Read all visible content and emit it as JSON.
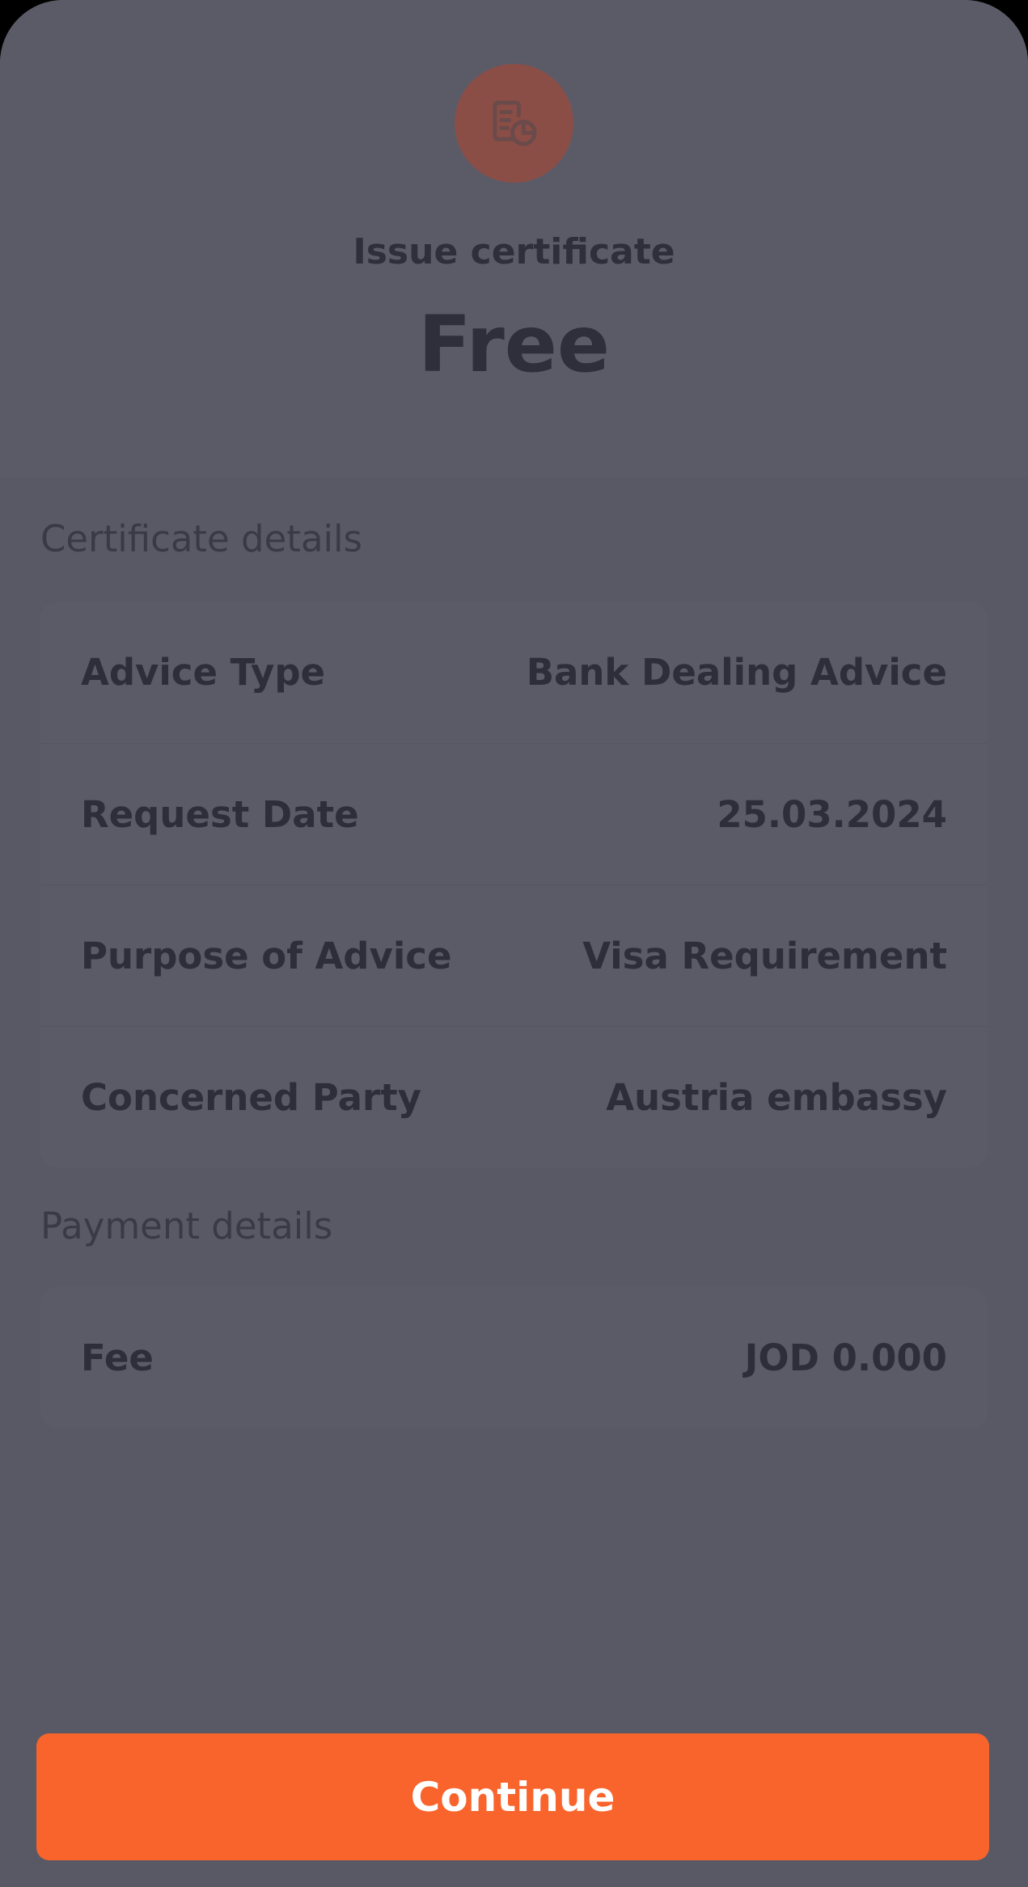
{
  "header": {
    "icon": "certificate-document-icon",
    "subtitle": "Issue certificate",
    "amount": "Free"
  },
  "certificate_details": {
    "title": "Certificate details",
    "rows": [
      {
        "label": "Advice Type",
        "value": "Bank Dealing Advice"
      },
      {
        "label": "Request Date",
        "value": "25.03.2024"
      },
      {
        "label": "Purpose of Advice",
        "value": "Visa Requirement"
      },
      {
        "label": "Concerned Party",
        "value": "Austria embassy"
      }
    ]
  },
  "payment_details": {
    "title": "Payment details",
    "rows": [
      {
        "label": "Fee",
        "value": "JOD 0.000"
      }
    ]
  },
  "actions": {
    "continue_label": "Continue"
  },
  "colors": {
    "accent": "#f9642c",
    "badge": "#8a4e46",
    "overlay": "#595966"
  }
}
